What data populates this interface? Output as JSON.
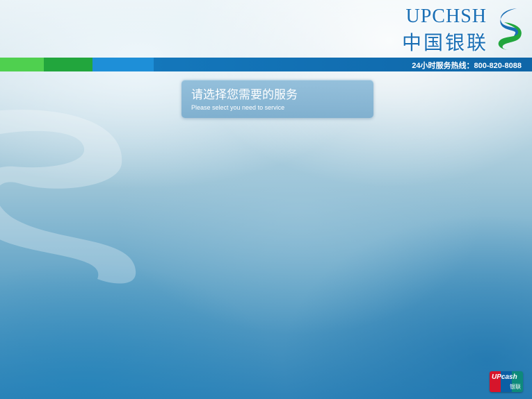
{
  "header": {
    "brand_en": "UPCHSH",
    "brand_cn": "中国银联",
    "hotline": "24小时服务热线：800-820-8088"
  },
  "prompt": {
    "title": "请选择您需要的服务",
    "subtitle": "Please select you need to service"
  },
  "badge": {
    "text": "UPcash",
    "cn": "银联"
  },
  "icons": {
    "logo": "swirl-logo-icon",
    "watermark": "swirl-watermark-icon"
  },
  "colors": {
    "brand_blue": "#1a6fb5",
    "stripe_green_light": "#4fd04f",
    "stripe_green": "#22a63d",
    "stripe_blue": "#1477bb"
  }
}
